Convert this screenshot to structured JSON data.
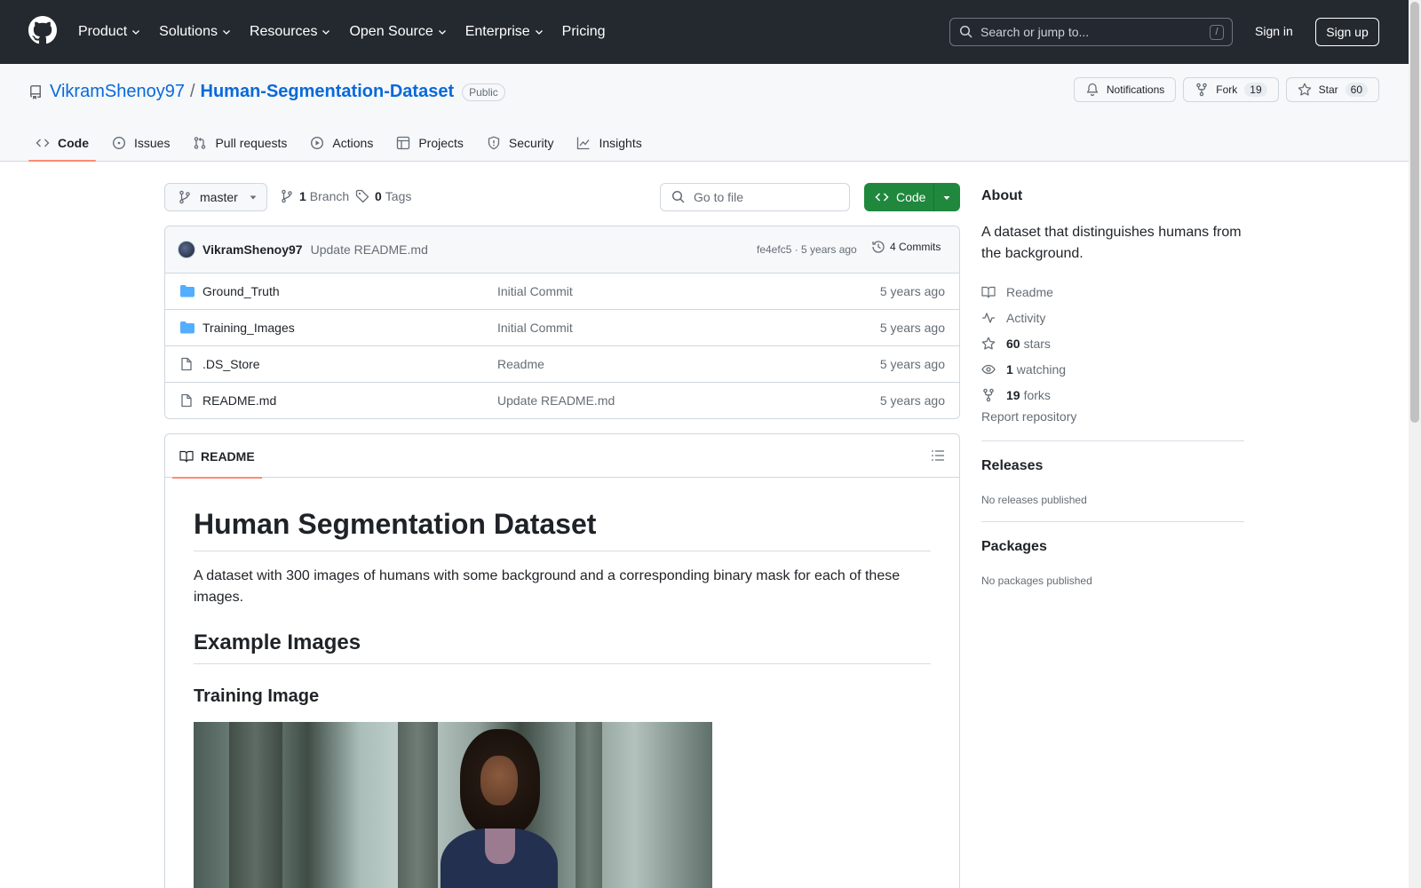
{
  "header": {
    "nav": [
      {
        "label": "Product",
        "dropdown": true
      },
      {
        "label": "Solutions",
        "dropdown": true
      },
      {
        "label": "Resources",
        "dropdown": true
      },
      {
        "label": "Open Source",
        "dropdown": true
      },
      {
        "label": "Enterprise",
        "dropdown": true
      },
      {
        "label": "Pricing",
        "dropdown": false
      }
    ],
    "search_placeholder": "Search or jump to...",
    "search_shortcut": "/",
    "signin": "Sign in",
    "signup": "Sign up"
  },
  "repo": {
    "owner": "VikramShenoy97",
    "separator": "/",
    "name": "Human-Segmentation-Dataset",
    "visibility": "Public",
    "notifications_label": "Notifications",
    "fork_label": "Fork",
    "fork_count": "19",
    "star_label": "Star",
    "star_count": "60"
  },
  "tabs": [
    {
      "label": "Code",
      "icon": "code-icon",
      "active": true
    },
    {
      "label": "Issues",
      "icon": "issue-icon"
    },
    {
      "label": "Pull requests",
      "icon": "pull-request-icon"
    },
    {
      "label": "Actions",
      "icon": "play-icon"
    },
    {
      "label": "Projects",
      "icon": "table-icon"
    },
    {
      "label": "Security",
      "icon": "shield-icon"
    },
    {
      "label": "Insights",
      "icon": "graph-icon"
    }
  ],
  "toolbar": {
    "branch": "master",
    "branch_count": "1",
    "branch_label": "Branch",
    "tag_count": "0",
    "tag_label": "Tags",
    "goto_placeholder": "Go to file",
    "code_label": "Code"
  },
  "latest_commit": {
    "author": "VikramShenoy97",
    "message": "Update README.md",
    "meta": "fe4efc5 · 5 years ago",
    "commits_label": "4 Commits"
  },
  "files": [
    {
      "name": "Ground_Truth",
      "type": "folder",
      "message": "Initial Commit",
      "age": "5 years ago"
    },
    {
      "name": "Training_Images",
      "type": "folder",
      "message": "Initial Commit",
      "age": "5 years ago"
    },
    {
      "name": ".DS_Store",
      "type": "file",
      "message": "Readme",
      "age": "5 years ago"
    },
    {
      "name": "README.md",
      "type": "file",
      "message": "Update README.md",
      "age": "5 years ago"
    }
  ],
  "readme": {
    "tab_label": "README",
    "title": "Human Segmentation Dataset",
    "description": "A dataset with 300 images of humans with some background and a corresponding binary mask for each of these images.",
    "h2": "Example Images",
    "h3": "Training Image"
  },
  "sidebar": {
    "about_heading": "About",
    "about_description": "A dataset that distinguishes humans from the background.",
    "items": [
      {
        "icon": "book-icon",
        "count": "",
        "label": "Readme"
      },
      {
        "icon": "pulse-icon",
        "count": "",
        "label": "Activity"
      },
      {
        "icon": "star-icon",
        "count": "60",
        "label": "stars"
      },
      {
        "icon": "eye-icon",
        "count": "1",
        "label": "watching"
      },
      {
        "icon": "fork-icon",
        "count": "19",
        "label": "forks"
      }
    ],
    "report": "Report repository",
    "releases_heading": "Releases",
    "releases_text": "No releases published",
    "packages_heading": "Packages",
    "packages_text": "No packages published"
  },
  "colors": {
    "header_bg": "#24292f",
    "link": "#0969da",
    "primary_button": "#1f883d",
    "active_tab_underline": "#fd8c73",
    "folder": "#54aeff"
  }
}
